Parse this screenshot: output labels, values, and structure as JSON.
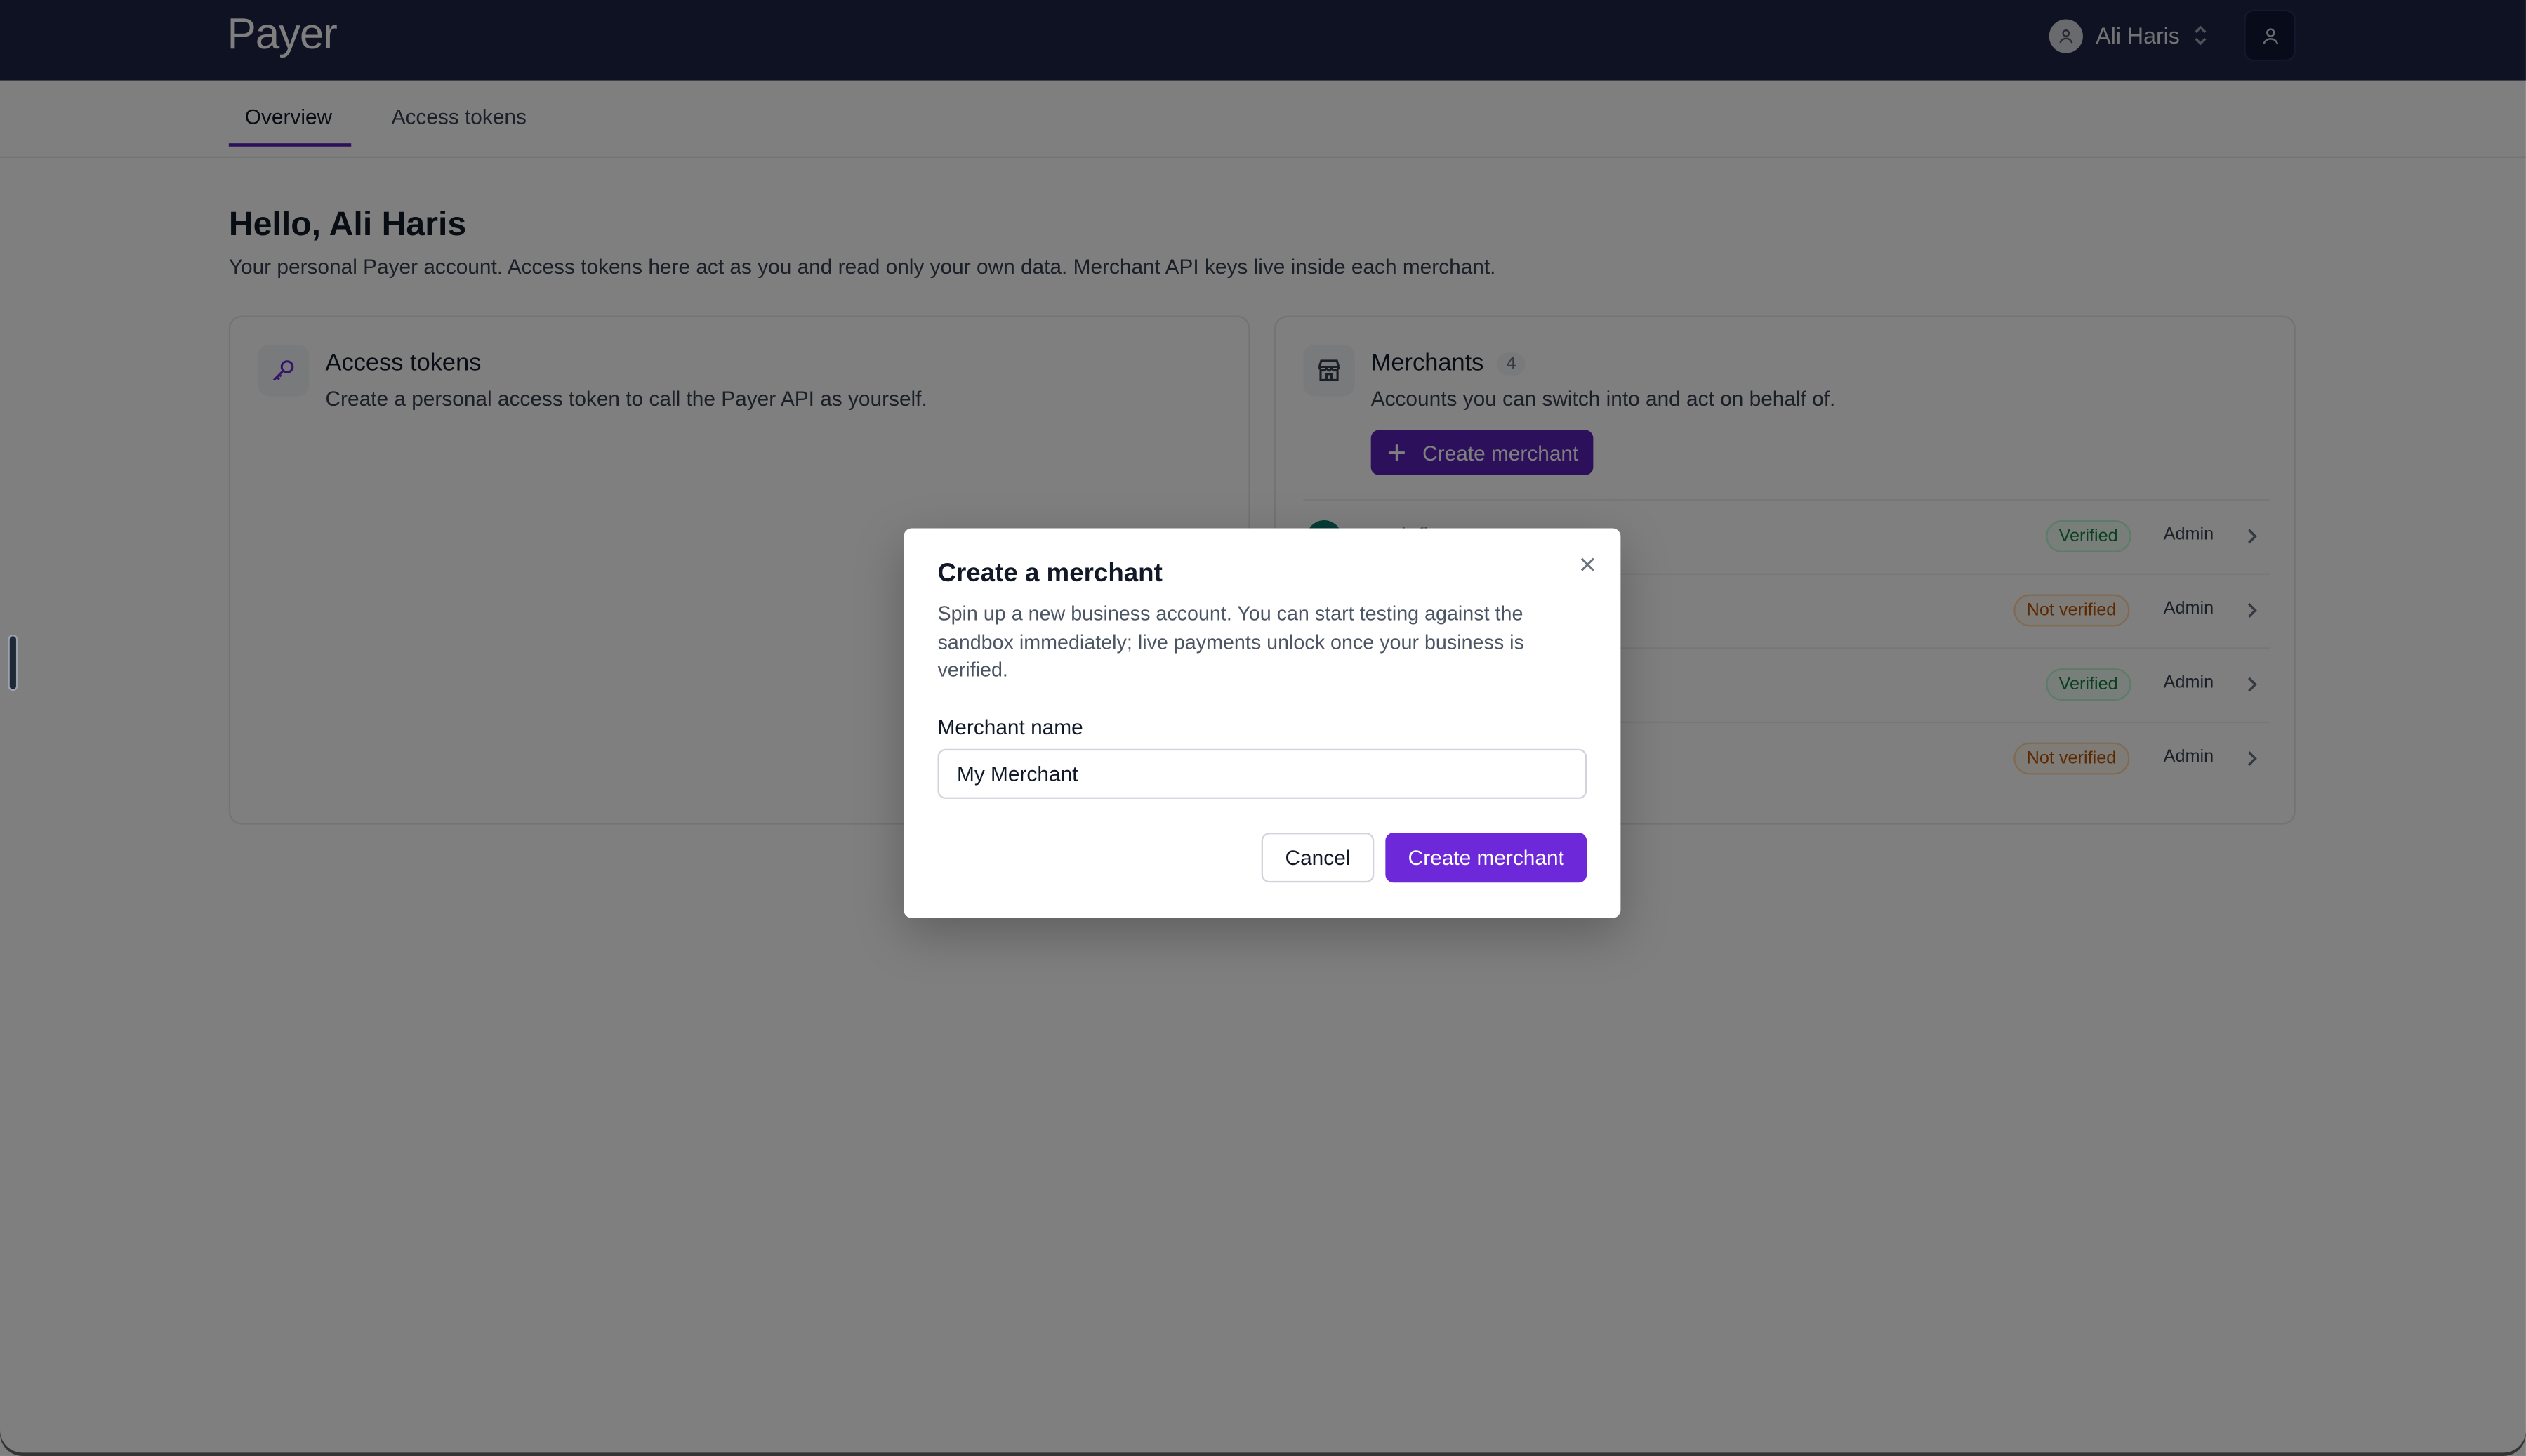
{
  "app": {
    "logo_text": "Payer"
  },
  "header": {
    "user_name": "Ali Haris",
    "icons": {
      "avatar": "user-circle-icon",
      "switch": "chevron-up-down-icon",
      "profile": "user-icon"
    }
  },
  "tabs": [
    {
      "label": "Overview",
      "active": true
    },
    {
      "label": "Access tokens",
      "active": false
    }
  ],
  "page": {
    "greeting": "Hello, Ali Haris",
    "intro": "Your personal Payer account. Access tokens here act as you and read only your own data. Merchant API keys live inside each merchant."
  },
  "access_tokens_card": {
    "title": "Access tokens",
    "subtitle": "Create a personal access token to call the Payer API as yourself.",
    "icon": "key-icon"
  },
  "merchants_card": {
    "title": "Merchants",
    "count": "4",
    "subtitle": "Accounts you can switch into and act on behalf of.",
    "create_label": "Create merchant",
    "icon": "storefront-icon",
    "rows": [
      {
        "name": "Verdafi",
        "status": "Verified",
        "status_kind": "ok",
        "role": "Admin"
      },
      {
        "name": "",
        "status": "Not verified",
        "status_kind": "no",
        "role": "Admin"
      },
      {
        "name": "",
        "status": "Verified",
        "status_kind": "ok",
        "role": "Admin"
      },
      {
        "name": "",
        "status": "Not verified",
        "status_kind": "no",
        "role": "Admin"
      }
    ]
  },
  "modal": {
    "title": "Create a merchant",
    "description": "Spin up a new business account. You can start testing against the sandbox immediately; live payments unlock once your business is verified.",
    "field_label": "Merchant name",
    "field_value": "My Merchant",
    "cancel_label": "Cancel",
    "submit_label": "Create merchant"
  },
  "colors": {
    "topbar": "#1e2547",
    "accent": "#6d28d9",
    "verified": "#15803d",
    "not_verified": "#b45309"
  }
}
